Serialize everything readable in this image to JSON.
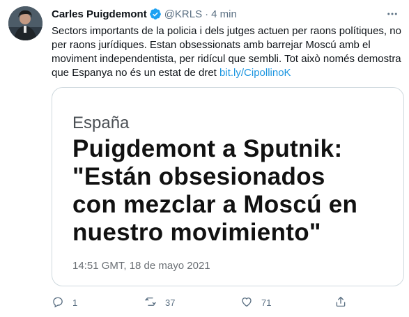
{
  "author": {
    "name": "Carles Puigdemont",
    "handle": "@KRLS",
    "separator": "·",
    "time": "4 min",
    "verified": true
  },
  "tweet": {
    "text": "Sectors importants de la policia i dels jutges actuen per raons polítiques, no per raons jurídiques. Estan obsessionats amb barrejar Moscú amb el moviment independentista, per ridícul que sembli. Tot això només demostra que Espanya no és un estat de dret ",
    "link": "bit.ly/CipollinoK"
  },
  "card": {
    "category": "España",
    "headline_lines": [
      "Puigdemont a Sputnik:",
      "\"Están obsesionados",
      "con mezclar a Moscú en",
      "nuestro movimiento\""
    ],
    "date": "14:51 GMT, 18 de mayo 2021"
  },
  "actions": {
    "reply_count": "1",
    "retweet_count": "37",
    "like_count": "71"
  },
  "icons": {
    "verified": "verified-badge-icon",
    "more": "more-options-icon",
    "reply": "reply-icon",
    "retweet": "retweet-icon",
    "like": "heart-icon",
    "share": "share-icon"
  },
  "colors": {
    "text": "#0f1419",
    "secondary": "#5b7083",
    "link": "#1b95e0",
    "verified": "#1da1f2",
    "card_border": "#cfd9de"
  }
}
